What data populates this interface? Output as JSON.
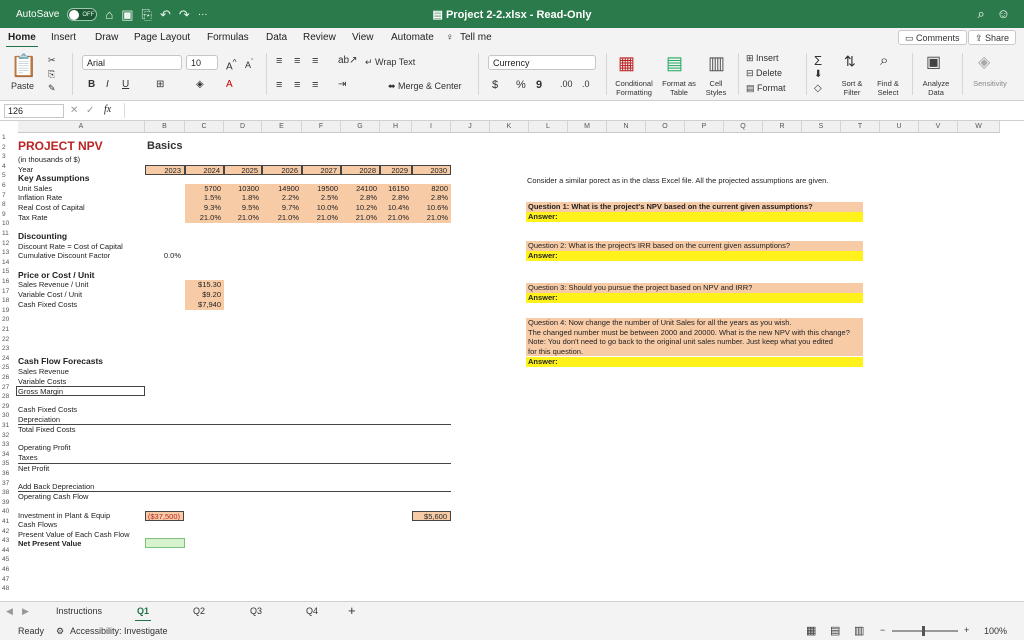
{
  "titlebar": {
    "autosave_label": "AutoSave",
    "autosave_state": "OFF",
    "more": "···",
    "file_title": "Project 2-2.xlsx - Read-Only"
  },
  "menu": {
    "items": [
      "Home",
      "Insert",
      "Draw",
      "Page Layout",
      "Formulas",
      "Data",
      "Review",
      "View",
      "Automate"
    ],
    "tell_me": "Tell me",
    "comments": "Comments",
    "share": "Share"
  },
  "ribbon": {
    "paste": "Paste",
    "font_name": "Arial",
    "font_size": "10",
    "wrap_text": "Wrap Text",
    "merge_center": "Merge & Center",
    "number_format": "Currency",
    "currency_symbol": "$",
    "percent_symbol": "%",
    "comma_symbol": "9",
    "conditional_formatting": "Conditional Formatting",
    "format_as_table": "Format as Table",
    "cell_styles": "Cell Styles",
    "insert": "Insert",
    "delete": "Delete",
    "format": "Format",
    "sort_filter": "Sort & Filter",
    "find_select": "Find & Select",
    "analyze_data": "Analyze Data",
    "sensitivity": "Sensitivity"
  },
  "formula_bar": {
    "name_box": "126",
    "fx": "fx"
  },
  "columns": [
    "A",
    "B",
    "C",
    "D",
    "E",
    "F",
    "G",
    "H",
    "I",
    "J",
    "K",
    "L",
    "M",
    "N",
    "O",
    "P",
    "Q",
    "R",
    "S",
    "T",
    "U",
    "V",
    "W"
  ],
  "sheet": {
    "title": "PROJECT NPV",
    "basics": "Basics",
    "thousands": "(in thousands of $)",
    "year_label": "Year",
    "years": [
      "2023",
      "2024",
      "2025",
      "2026",
      "2027",
      "2028",
      "2029",
      "2030"
    ],
    "key_assumptions": "Key Assumptions",
    "unit_sales_label": "Unit Sales",
    "unit_sales": [
      "5700",
      "10300",
      "14900",
      "19500",
      "24100",
      "16150",
      "8200"
    ],
    "inflation_label": "Inflation Rate",
    "inflation": [
      "1.5%",
      "1.8%",
      "2.2%",
      "2.5%",
      "2.8%",
      "2.8%",
      "2.8%"
    ],
    "real_cost_label": "Real Cost of Capital",
    "real_cost": [
      "9.3%",
      "9.5%",
      "9.7%",
      "10.0%",
      "10.2%",
      "10.4%",
      "10.6%"
    ],
    "tax_label": "Tax Rate",
    "tax": [
      "21.0%",
      "21.0%",
      "21.0%",
      "21.0%",
      "21.0%",
      "21.0%",
      "21.0%"
    ],
    "discounting": "Discounting",
    "discount_rate_label": "Discount Rate = Cost of Capital",
    "cum_discount_label": "Cumulative Discount Factor",
    "cum_discount_value": "0.0%",
    "price_cost": "Price or Cost / Unit",
    "sales_rev_unit_label": "Sales Revenue / Unit",
    "sales_rev_unit": "$15.30",
    "var_cost_unit_label": "Variable Cost / Unit",
    "var_cost_unit": "$9.20",
    "cash_fixed_label": "Cash Fixed Costs",
    "cash_fixed": "$7,940",
    "cash_flow_forecasts": "Cash Flow Forecasts",
    "sales_revenue": "Sales Revenue",
    "variable_costs": "Variable Costs",
    "gross_margin": "Gross Margin",
    "cash_fixed_costs": "Cash Fixed Costs",
    "depreciation": "Depreciation",
    "total_fixed_costs": "Total Fixed Costs",
    "operating_profit": "Operating Profit",
    "taxes": "Taxes",
    "net_profit": "Net Profit",
    "add_back_dep": "Add Back Depreciation",
    "operating_cash_flow": "Operating Cash Flow",
    "investment_label": "Investment in Plant & Equip",
    "investment_2023": "($37,500)",
    "investment_2030": "$5,600",
    "cash_flows": "Cash Flows",
    "pv_cash_flow": "Present Value of Each Cash Flow",
    "npv": "Net Present Value",
    "intro": "Consider a similar porect as in the class Excel file. All the projected assumptions are given.",
    "q1": "Question 1: What is the project's NPV based on the current given assumptions?",
    "q2": "Question 2: What is the project's IRR based on the current given assumptions?",
    "q3": "Question 3: Should you pursue the project based on NPV and IRR?",
    "q4_line1": "Question 4: Now change the number of Unit Sales for all the years as you wish.",
    "q4_line2": "The changed number must be between 2000 and 20000. What is the new NPV with this change?",
    "q4_line3": "Note: You don't need to go back to the original unit sales number. Just keep what you edited",
    "q4_line4": "for this question.",
    "answer": "Answer:"
  },
  "sheet_tabs": [
    "Instructions",
    "Q1",
    "Q2",
    "Q3",
    "Q4"
  ],
  "status": {
    "ready": "Ready",
    "accessibility": "Accessibility: Investigate",
    "zoom": "100%"
  }
}
